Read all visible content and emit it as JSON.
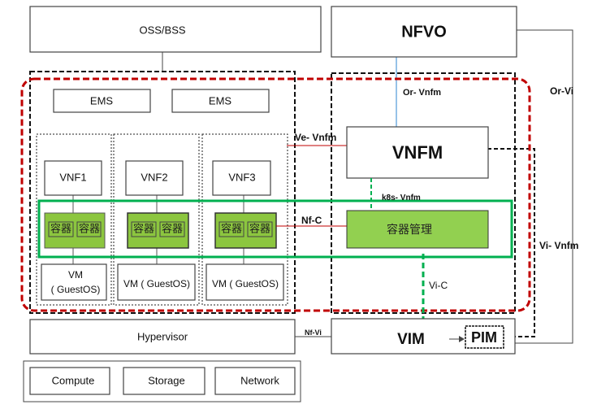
{
  "oss_bss": "OSS/BSS",
  "nfvo": "NFVO",
  "ems": [
    "EMS",
    "EMS"
  ],
  "vnfs": [
    "VNF1",
    "VNF2",
    "VNF3"
  ],
  "container": "容器",
  "vms": [
    {
      "line1": "VM",
      "line2": "( GuestOS)"
    },
    {
      "line1": "VM ( GuestOS)"
    },
    {
      "line1": "VM ( GuestOS)"
    }
  ],
  "vnfm": "VNFM",
  "container_mgmt": "容器管理",
  "hypervisor": "Hypervisor",
  "vim": "VIM",
  "pim": "PIM",
  "infra": [
    "Compute",
    "Storage",
    "Network"
  ],
  "interfaces": {
    "or_vnfm": "Or- Vnfm",
    "or_vi": "Or-Vi",
    "ve_vnfm": "Ve- Vnfm",
    "k8s_vnfm": "k8s- Vnfm",
    "nf_c": "Nf-C",
    "vi_c": "Vi-C",
    "vi_vnfm": "Vi- Vnfm",
    "nf_vi": "Nf-Vi"
  },
  "colors": {
    "green_fill": "#92d050",
    "green_border": "#00b050",
    "red_dash": "#c00000",
    "blue_line": "#4f9ad8"
  }
}
